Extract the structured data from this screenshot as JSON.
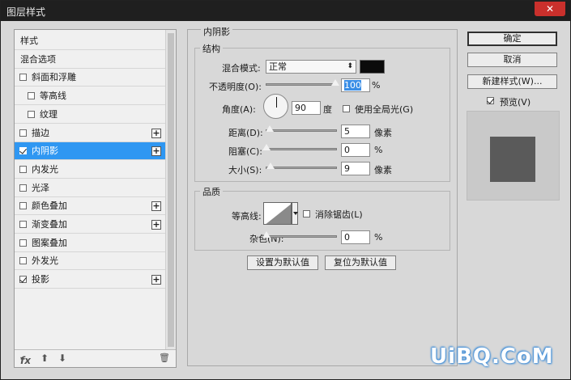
{
  "window": {
    "title": "图层样式",
    "close_glyph": "✕"
  },
  "left": {
    "items": [
      {
        "label": "样式",
        "checkbox": false,
        "checked": false,
        "plus": false,
        "indent": false,
        "selected": false
      },
      {
        "label": "混合选项",
        "checkbox": false,
        "checked": false,
        "plus": false,
        "indent": false,
        "selected": false
      },
      {
        "label": "斜面和浮雕",
        "checkbox": true,
        "checked": false,
        "plus": false,
        "indent": false,
        "selected": false
      },
      {
        "label": "等高线",
        "checkbox": true,
        "checked": false,
        "plus": false,
        "indent": true,
        "selected": false
      },
      {
        "label": "纹理",
        "checkbox": true,
        "checked": false,
        "plus": false,
        "indent": true,
        "selected": false
      },
      {
        "label": "描边",
        "checkbox": true,
        "checked": false,
        "plus": true,
        "indent": false,
        "selected": false
      },
      {
        "label": "内阴影",
        "checkbox": true,
        "checked": true,
        "plus": true,
        "indent": false,
        "selected": true
      },
      {
        "label": "内发光",
        "checkbox": true,
        "checked": false,
        "plus": false,
        "indent": false,
        "selected": false
      },
      {
        "label": "光泽",
        "checkbox": true,
        "checked": false,
        "plus": false,
        "indent": false,
        "selected": false
      },
      {
        "label": "颜色叠加",
        "checkbox": true,
        "checked": false,
        "plus": true,
        "indent": false,
        "selected": false
      },
      {
        "label": "渐变叠加",
        "checkbox": true,
        "checked": false,
        "plus": true,
        "indent": false,
        "selected": false
      },
      {
        "label": "图案叠加",
        "checkbox": true,
        "checked": false,
        "plus": false,
        "indent": false,
        "selected": false
      },
      {
        "label": "外发光",
        "checkbox": true,
        "checked": false,
        "plus": false,
        "indent": false,
        "selected": false
      },
      {
        "label": "投影",
        "checkbox": true,
        "checked": true,
        "plus": true,
        "indent": false,
        "selected": false
      }
    ],
    "toolbar": {
      "fx": "fx",
      "fx_arrow": "▾",
      "up": "⬆",
      "down": "⬇",
      "trash": "🗑"
    }
  },
  "center": {
    "panel_title": "内阴影",
    "structure": {
      "title": "结构",
      "blend_label": "混合模式:",
      "blend_value": "正常",
      "opacity_label": "不透明度(O):",
      "opacity_value": "100",
      "opacity_unit": "%",
      "angle_label": "角度(A):",
      "angle_value": "90",
      "angle_unit": "度",
      "global_light_label": "使用全局光(G)",
      "distance_label": "距离(D):",
      "distance_value": "5",
      "distance_unit": "像素",
      "choke_label": "阻塞(C):",
      "choke_value": "0",
      "choke_unit": "%",
      "size_label": "大小(S):",
      "size_value": "9",
      "size_unit": "像素"
    },
    "quality": {
      "title": "品质",
      "contour_label": "等高线:",
      "antialias_label": "消除锯齿(L)",
      "noise_label": "杂色(N):",
      "noise_value": "0",
      "noise_unit": "%"
    },
    "set_default": "设置为默认值",
    "reset_default": "复位为默认值"
  },
  "right": {
    "ok": "确定",
    "cancel": "取消",
    "new_style": "新建样式(W)...",
    "preview_label": "预览(V)"
  },
  "watermark": "UiBQ.CoM",
  "colors": {
    "selected": "#2f97f2",
    "shadow_color": "#0b0b0b",
    "preview_square": "#5a5a5a"
  }
}
